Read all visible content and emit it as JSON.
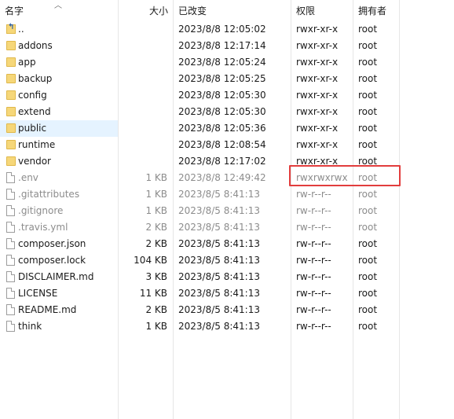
{
  "columns": {
    "name": "名字",
    "size": "大小",
    "date": "已改变",
    "perm": "权限",
    "owner": "拥有者"
  },
  "files": [
    {
      "icon": "up-folder-icon",
      "name": "..",
      "size": "",
      "date": "2023/8/8 12:05:02",
      "perm": "rwxr-xr-x",
      "owner": "root",
      "hidden": false
    },
    {
      "icon": "folder-icon",
      "name": "addons",
      "size": "",
      "date": "2023/8/8 12:17:14",
      "perm": "rwxr-xr-x",
      "owner": "root",
      "hidden": false
    },
    {
      "icon": "folder-icon",
      "name": "app",
      "size": "",
      "date": "2023/8/8 12:05:24",
      "perm": "rwxr-xr-x",
      "owner": "root",
      "hidden": false
    },
    {
      "icon": "folder-icon",
      "name": "backup",
      "size": "",
      "date": "2023/8/8 12:05:25",
      "perm": "rwxr-xr-x",
      "owner": "root",
      "hidden": false
    },
    {
      "icon": "folder-icon",
      "name": "config",
      "size": "",
      "date": "2023/8/8 12:05:30",
      "perm": "rwxr-xr-x",
      "owner": "root",
      "hidden": false
    },
    {
      "icon": "folder-icon",
      "name": "extend",
      "size": "",
      "date": "2023/8/8 12:05:30",
      "perm": "rwxr-xr-x",
      "owner": "root",
      "hidden": false
    },
    {
      "icon": "folder-icon",
      "name": "public",
      "size": "",
      "date": "2023/8/8 12:05:36",
      "perm": "rwxr-xr-x",
      "owner": "root",
      "hidden": false,
      "selected": true
    },
    {
      "icon": "folder-icon",
      "name": "runtime",
      "size": "",
      "date": "2023/8/8 12:08:54",
      "perm": "rwxr-xr-x",
      "owner": "root",
      "hidden": false
    },
    {
      "icon": "folder-icon",
      "name": "vendor",
      "size": "",
      "date": "2023/8/8 12:17:02",
      "perm": "rwxr-xr-x",
      "owner": "root",
      "hidden": false
    },
    {
      "icon": "file-icon",
      "name": ".env",
      "size": "1 KB",
      "date": "2023/8/8 12:49:42",
      "perm": "rwxrwxrwx",
      "owner": "root",
      "hidden": true
    },
    {
      "icon": "file-icon",
      "name": ".gitattributes",
      "size": "1 KB",
      "date": "2023/8/5 8:41:13",
      "perm": "rw-r--r--",
      "owner": "root",
      "hidden": true
    },
    {
      "icon": "file-icon",
      "name": ".gitignore",
      "size": "1 KB",
      "date": "2023/8/5 8:41:13",
      "perm": "rw-r--r--",
      "owner": "root",
      "hidden": true
    },
    {
      "icon": "file-icon",
      "name": ".travis.yml",
      "size": "2 KB",
      "date": "2023/8/5 8:41:13",
      "perm": "rw-r--r--",
      "owner": "root",
      "hidden": true
    },
    {
      "icon": "file-icon",
      "name": "composer.json",
      "size": "2 KB",
      "date": "2023/8/5 8:41:13",
      "perm": "rw-r--r--",
      "owner": "root",
      "hidden": false
    },
    {
      "icon": "file-icon",
      "name": "composer.lock",
      "size": "104 KB",
      "date": "2023/8/5 8:41:13",
      "perm": "rw-r--r--",
      "owner": "root",
      "hidden": false
    },
    {
      "icon": "file-icon",
      "name": "DISCLAIMER.md",
      "size": "3 KB",
      "date": "2023/8/5 8:41:13",
      "perm": "rw-r--r--",
      "owner": "root",
      "hidden": false
    },
    {
      "icon": "file-icon",
      "name": "LICENSE",
      "size": "11 KB",
      "date": "2023/8/5 8:41:13",
      "perm": "rw-r--r--",
      "owner": "root",
      "hidden": false
    },
    {
      "icon": "file-icon",
      "name": "README.md",
      "size": "2 KB",
      "date": "2023/8/5 8:41:13",
      "perm": "rw-r--r--",
      "owner": "root",
      "hidden": false
    },
    {
      "icon": "file-icon",
      "name": "think",
      "size": "1 KB",
      "date": "2023/8/5 8:41:13",
      "perm": "rw-r--r--",
      "owner": "root",
      "hidden": false
    }
  ],
  "annotation": {
    "color": "#e23d3d"
  }
}
